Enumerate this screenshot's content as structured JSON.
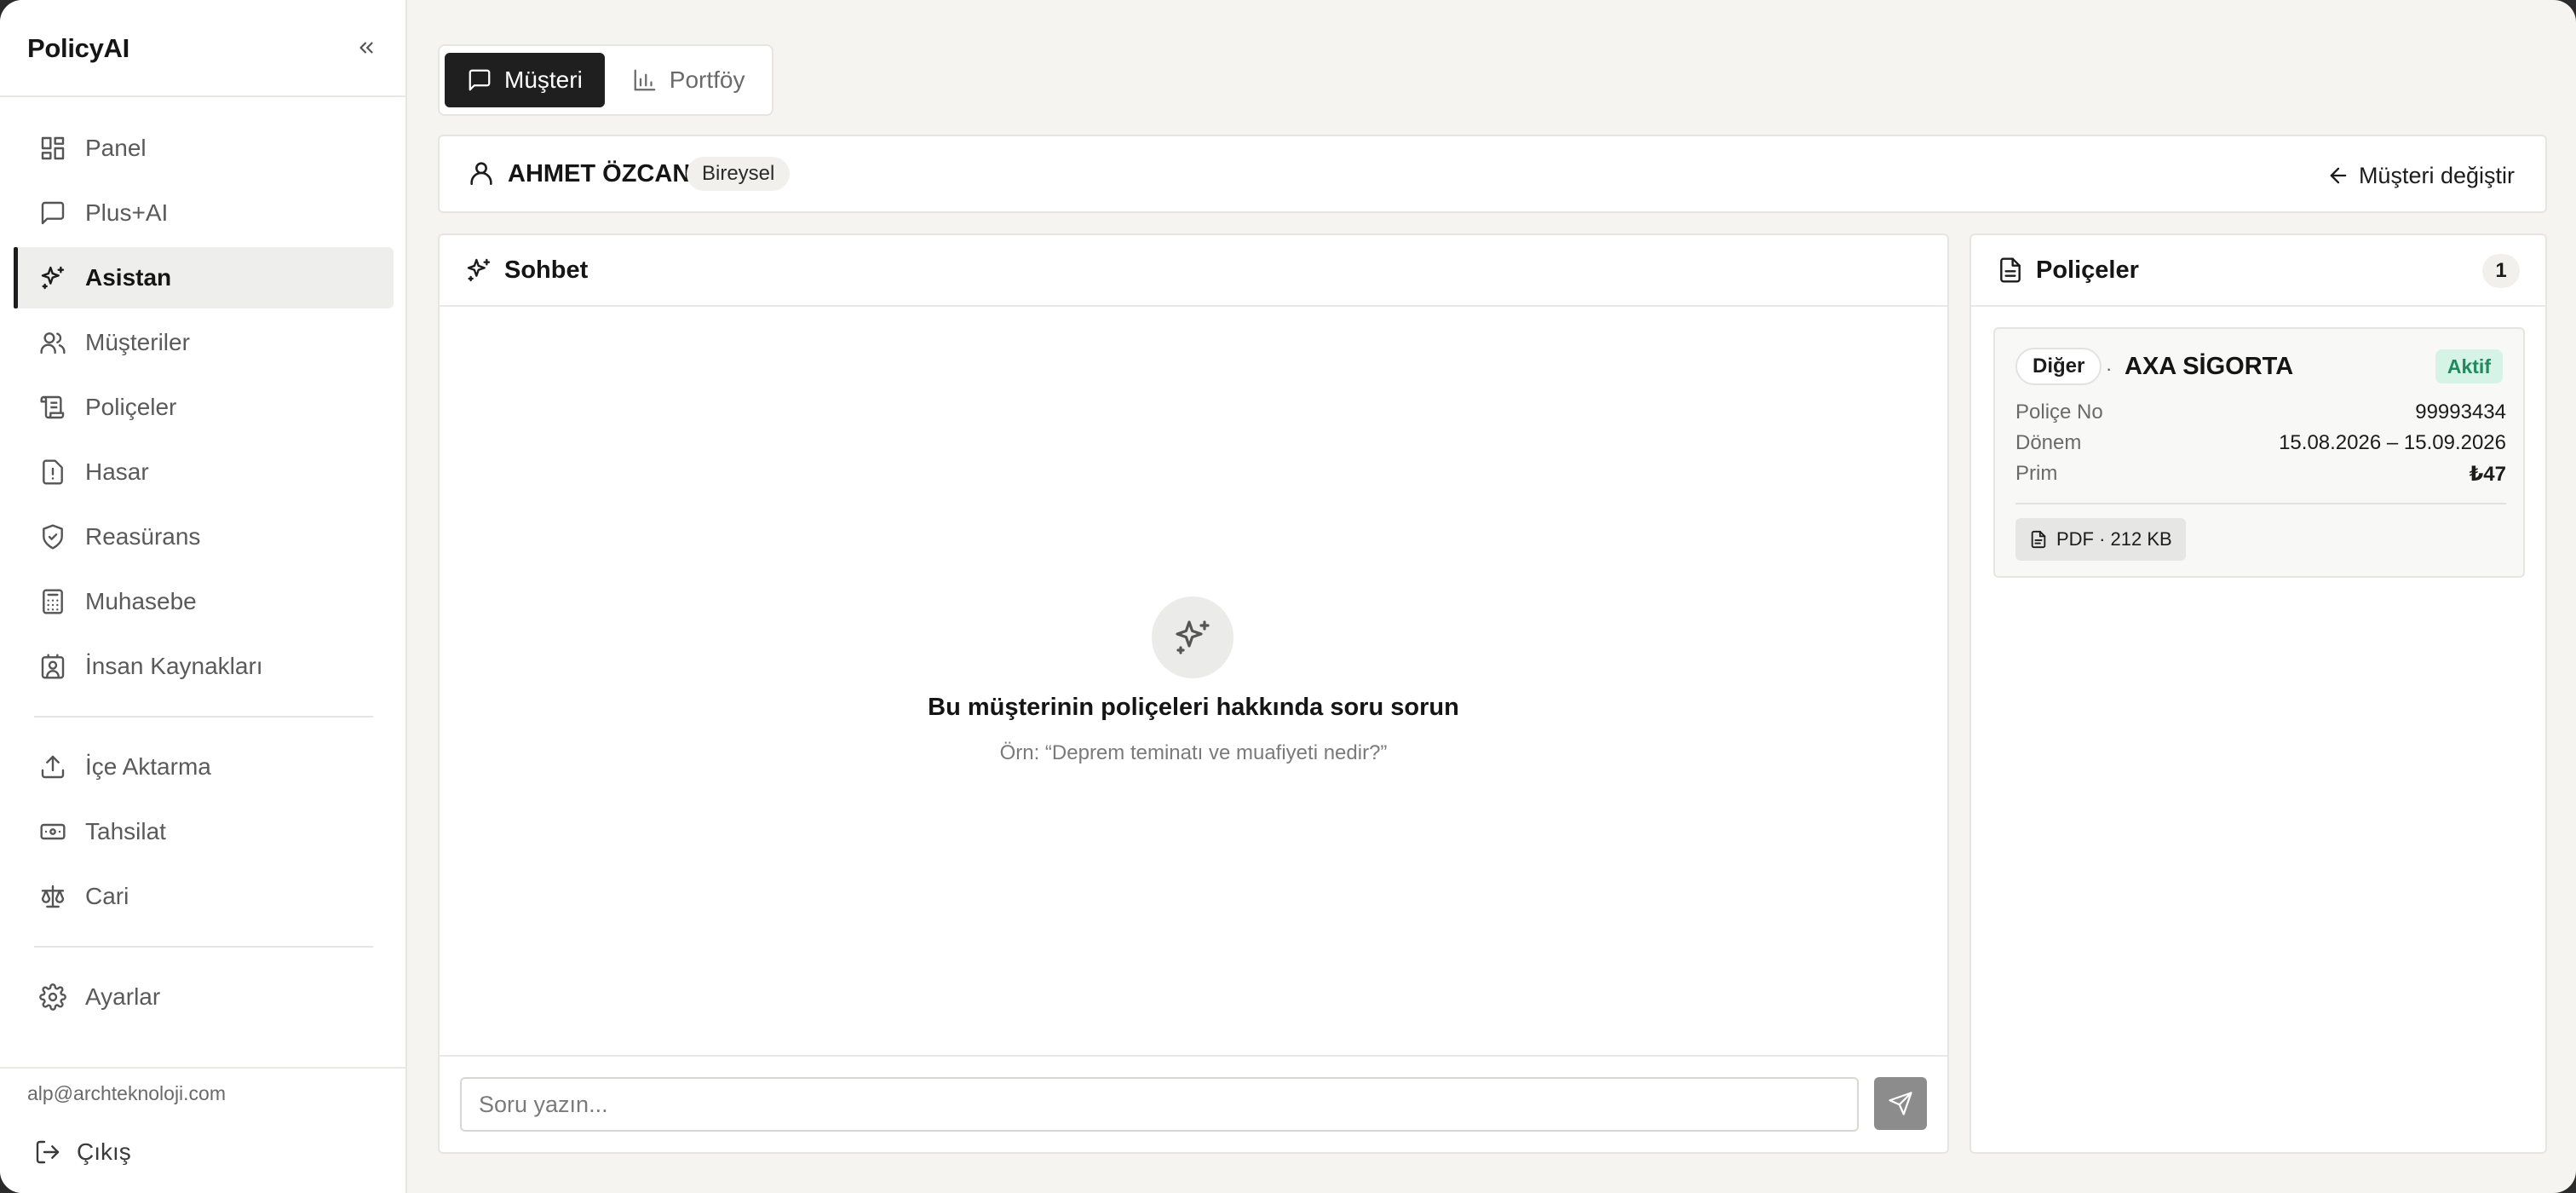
{
  "sidebar": {
    "brand": "PolicyAI",
    "items": [
      {
        "label": "Panel",
        "icon": "dashboard-icon"
      },
      {
        "label": "Plus+AI",
        "icon": "message-square-icon"
      },
      {
        "label": "Asistan",
        "icon": "sparkles-icon",
        "active": true
      },
      {
        "label": "Müşteriler",
        "icon": "users-icon"
      },
      {
        "label": "Poliçeler",
        "icon": "scroll-icon"
      },
      {
        "label": "Hasar",
        "icon": "file-alert-icon"
      },
      {
        "label": "Reasürans",
        "icon": "shield-check-icon"
      },
      {
        "label": "Muhasebe",
        "icon": "calculator-icon"
      },
      {
        "label": "İnsan Kaynakları",
        "icon": "contact-icon"
      }
    ],
    "items2": [
      {
        "label": "İçe Aktarma",
        "icon": "upload-icon"
      },
      {
        "label": "Tahsilat",
        "icon": "banknote-icon"
      },
      {
        "label": "Cari",
        "icon": "scale-icon"
      }
    ],
    "items3": [
      {
        "label": "Ayarlar",
        "icon": "gear-icon"
      }
    ],
    "email": "alp@archteknoloji.com",
    "logout": "Çıkış"
  },
  "tabs": {
    "customer": "Müşteri",
    "portfolio": "Portföy"
  },
  "customer": {
    "name": "AHMET ÖZCAN",
    "type": "Bireysel",
    "change_label": "Müşteri değiştir"
  },
  "chat": {
    "title": "Sohbet",
    "empty_title": "Bu müşterinin poliçeleri hakkında soru sorun",
    "empty_hint": "Örn: “Deprem teminatı ve muafiyeti nedir?”",
    "input_placeholder": "Soru yazın..."
  },
  "policies": {
    "title": "Poliçeler",
    "count": "1",
    "cards": [
      {
        "type": "Diğer",
        "separator": "·",
        "company": "AXA SİGORTA",
        "status": "Aktif",
        "policy_no_label": "Poliçe No",
        "policy_no": "99993434",
        "period_label": "Dönem",
        "period": "15.08.2026 – 15.09.2026",
        "premium_label": "Prim",
        "premium": "₺47",
        "document": "PDF · 212 KB"
      }
    ]
  },
  "colors": {
    "accent": "#1f1f1f",
    "status_active_bg": "#d5f3e6",
    "status_active_text": "#1f8a5b",
    "send_button": "#8c8c8c"
  }
}
